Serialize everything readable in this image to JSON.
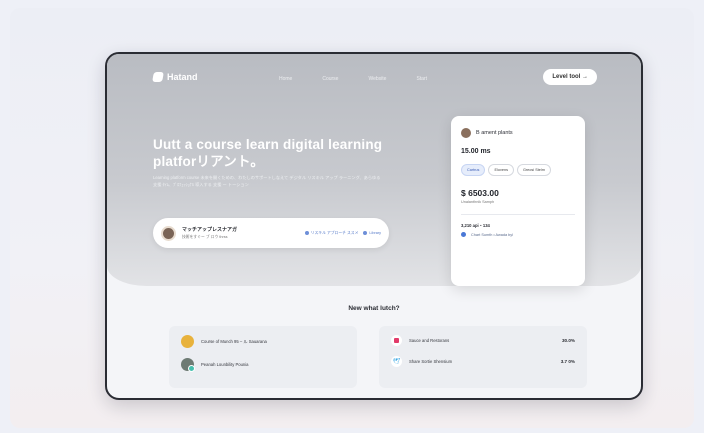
{
  "nav": {
    "logo": "Hatand",
    "links": [
      "Home",
      "Course",
      "Website",
      "Start"
    ],
    "cta": "Level tool"
  },
  "hero": {
    "title": "Uutt a course learn digital learning platforリアント。",
    "description": "Learning platform course 未来を開くための、わたしのサポートしなえて デジタル リスキル アップ ラーニング、あらゆる 支援 ﾀｲﾑ、ﾌﾟﾛﾌｪｯｼｮﾅﾙ 導入する 支援 ー トーション",
    "profile_name": "マッチアップレスナアガ",
    "profile_sub": "技術をすぐー ブ ロウ thrss",
    "tags": [
      "リスキル アプローチ ススメ",
      "Library"
    ]
  },
  "card": {
    "title": "B ament plants",
    "price": "15.00 ms",
    "chips": [
      "Cartrus",
      "Elovens",
      "Greosi Stelm"
    ],
    "amount": "$ 6503.00",
    "amount_sub": "Unalanthnik Samph",
    "foot": "3,210 api・134",
    "link": "Chart Sumth • Awada byl"
  },
  "section": {
    "title": "New what lutch?"
  },
  "left_panel": {
    "items": [
      {
        "text": "Course of Munch 95 – ル Sauarana"
      },
      {
        "text": "Peanah Lounbility Pounia"
      }
    ]
  },
  "right_panel": {
    "items": [
      {
        "text": "Sauce and Restorans",
        "value": "30.0%"
      },
      {
        "text": "Share Sortie Shensium",
        "value": "3.7 0%"
      }
    ]
  },
  "icons": {
    "logo": "leaf-logo-icon",
    "right_1": "pink-square-icon",
    "right_2": "twitter-bird-icon"
  },
  "colors": {
    "hero_top": "#b9bcc2",
    "accent_blue": "#4a78d6",
    "pink": "#e23b6a",
    "twitter": "#3aa8e4"
  }
}
